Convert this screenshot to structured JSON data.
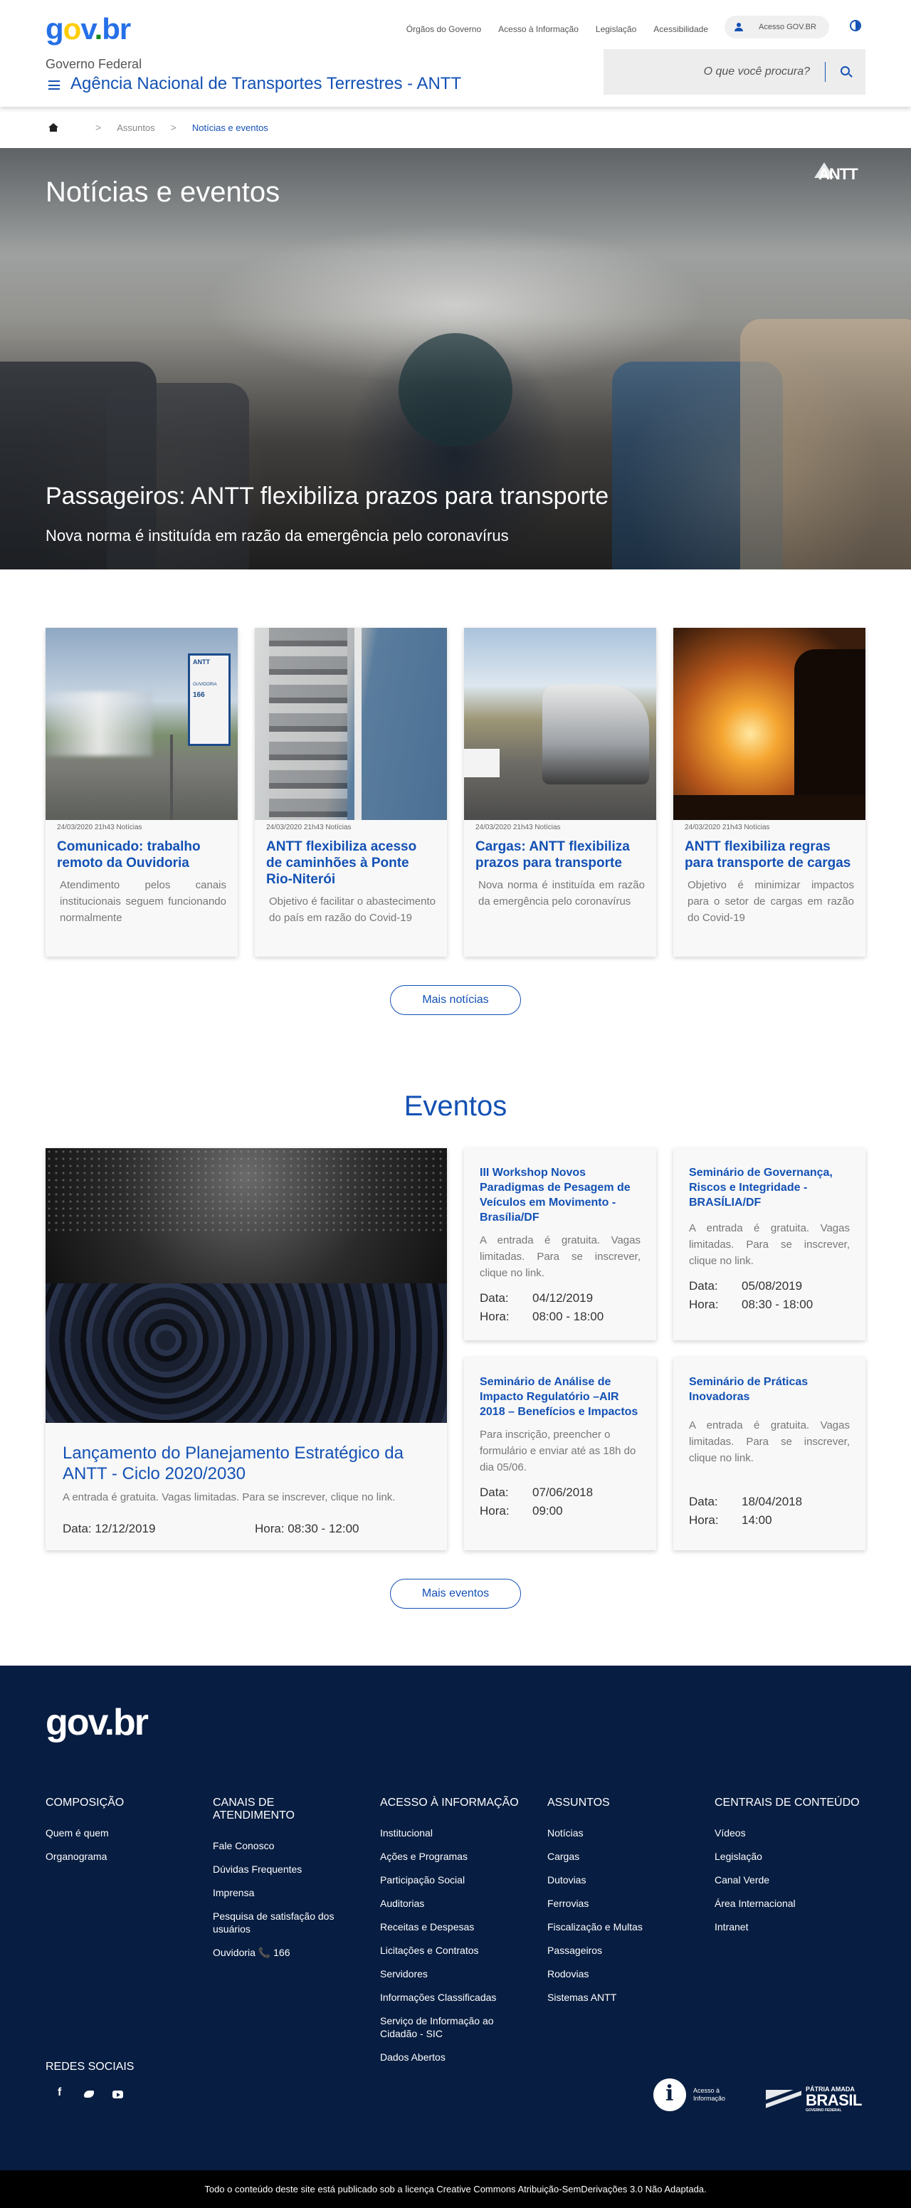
{
  "header": {
    "logo": {
      "g": "g",
      "o": "o",
      "v": "v",
      "dot": ".",
      "b": "b",
      "r": "r"
    },
    "top_links": [
      "Órgãos do Governo",
      "Acesso à Informação",
      "Legislação",
      "Acessibilidade"
    ],
    "login_label": "Acesso GOV.BR",
    "gov_label": "Governo Federal",
    "agency": "Agência Nacional de Transportes Terrestres - ANTT",
    "search_placeholder": "O que você procura?"
  },
  "breadcrumb": {
    "items": [
      "Assuntos",
      "Notícias e eventos"
    ],
    "separator": ">"
  },
  "hero": {
    "title": "Notícias e eventos",
    "logo_text": "ANTT",
    "headline": "Passageiros: ANTT flexibiliza prazos para transporte",
    "subtitle": "Nova norma é instituída em razão da emergência pelo coronavírus"
  },
  "news": {
    "cards": [
      {
        "meta": "24/03/2020 21h43 Notícias",
        "title": "Comunicado: trabalho remoto da Ouvidoria",
        "desc": "Atendimento pelos canais institucionais seguem funcionando normalmente",
        "sign": "ANTT",
        "sign_line1": "OUVIDORIA",
        "sign_line2": "166"
      },
      {
        "meta": "24/03/2020 21h43 Notícias",
        "title": "ANTT flexibiliza acesso de caminhões à Ponte Rio-Niterói",
        "desc": "Objetivo é facilitar o abastecimento do país em razão do Covid-19"
      },
      {
        "meta": "24/03/2020 21h43 Notícias",
        "title": "Cargas: ANTT flexibiliza prazos para transporte",
        "desc": "Nova norma é instituída em razão da emergência pelo coronavírus"
      },
      {
        "meta": "24/03/2020 21h43 Notícias",
        "title": "ANTT flexibiliza regras para transporte de cargas",
        "desc": "Objetivo é minimizar impactos para o setor de cargas em razão do Covid-19"
      }
    ],
    "more_label": "Mais notícias"
  },
  "events": {
    "title": "Eventos",
    "featured": {
      "title": "Lançamento do Planejamento Estratégico da ANTT - Ciclo 2020/2030",
      "desc": "A entrada é gratuita. Vagas limitadas. Para se inscrever, clique no link.",
      "date": "Data: 12/12/2019",
      "time": "Hora: 08:30 - 12:00"
    },
    "items": [
      {
        "title": "III Workshop Novos Paradigmas de Pesagem de Veículos em Movimento - Brasília/DF",
        "desc": "A entrada é gratuita. Vagas limitadas. Para se inscrever, clique no link.",
        "date_label": "Data:",
        "date": "04/12/2019",
        "time_label": "Hora:",
        "time": "08:00 - 18:00"
      },
      {
        "title": "Seminário de Governança, Riscos e Integridade - BRASÍLIA/DF",
        "desc": "A entrada é gratuita. Vagas limitadas. Para se inscrever, clique no link.",
        "date_label": "Data:",
        "date": "05/08/2019",
        "time_label": "Hora:",
        "time": "08:30 - 18:00"
      },
      {
        "title": "Seminário de Análise de Impacto Regulatório –AIR 2018 – Benefícios e Impactos",
        "desc": "Para inscrição, preencher o formulário e enviar até as 18h do dia 05/06.",
        "date_label": "Data:",
        "date": "07/06/2018",
        "time_label": "Hora:",
        "time": "09:00"
      },
      {
        "title": "Seminário de Práticas Inovadoras",
        "desc": "A entrada é gratuita. Vagas limitadas. Para se inscrever, clique no link.",
        "date_label": "Data:",
        "date": "18/04/2018",
        "time_label": "Hora:",
        "time": "14:00"
      }
    ],
    "more_label": "Mais eventos"
  },
  "footer": {
    "logo": "gov.br",
    "columns": [
      {
        "title": "COMPOSIÇÃO",
        "links": [
          "Quem é quem",
          "Organograma"
        ]
      },
      {
        "title": "CANAIS DE ATENDIMENTO",
        "links": [
          "Fale Conosco",
          "Dúvidas Frequentes",
          "Imprensa",
          "Pesquisa de satisfação dos usuários",
          "Ouvidoria 📞 166"
        ]
      },
      {
        "title": "ACESSO À INFORMAÇÃO",
        "links": [
          "Institucional",
          "Ações e Programas",
          "Participação Social",
          "Auditorias",
          "Receitas e Despesas",
          "Licitações e Contratos",
          "Servidores",
          "Informações Classificadas",
          "Serviço de Informação ao Cidadão - SIC",
          "Dados Abertos"
        ]
      },
      {
        "title": "ASSUNTOS",
        "links": [
          "Notícias",
          "Cargas",
          "Dutovias",
          "Ferrovias",
          "Fiscalização e Multas",
          "Passageiros",
          "Rodovias",
          "Sistemas ANTT"
        ]
      },
      {
        "title": "CENTRAIS DE CONTEÚDO",
        "links": [
          "Vídeos",
          "Legislação",
          "Canal Verde",
          "Área Internacional",
          "Intranet"
        ]
      }
    ],
    "social_title": "REDES SOCIAIS",
    "social": [
      "facebook-icon",
      "twitter-icon",
      "youtube-icon"
    ],
    "acesso_info_label": "Acesso à Informação",
    "brasil_top": "PÁTRIA AMADA",
    "brasil_big": "BRASIL",
    "brasil_bottom": "GOVERNO FEDERAL",
    "license": "Todo o conteúdo deste site está publicado sob a licença Creative Commons Atribuição-SemDerivações 3.0 Não Adaptada."
  },
  "colors": {
    "primary": "#1351b4",
    "footer_bg": "#071d41",
    "text": "#333333"
  }
}
